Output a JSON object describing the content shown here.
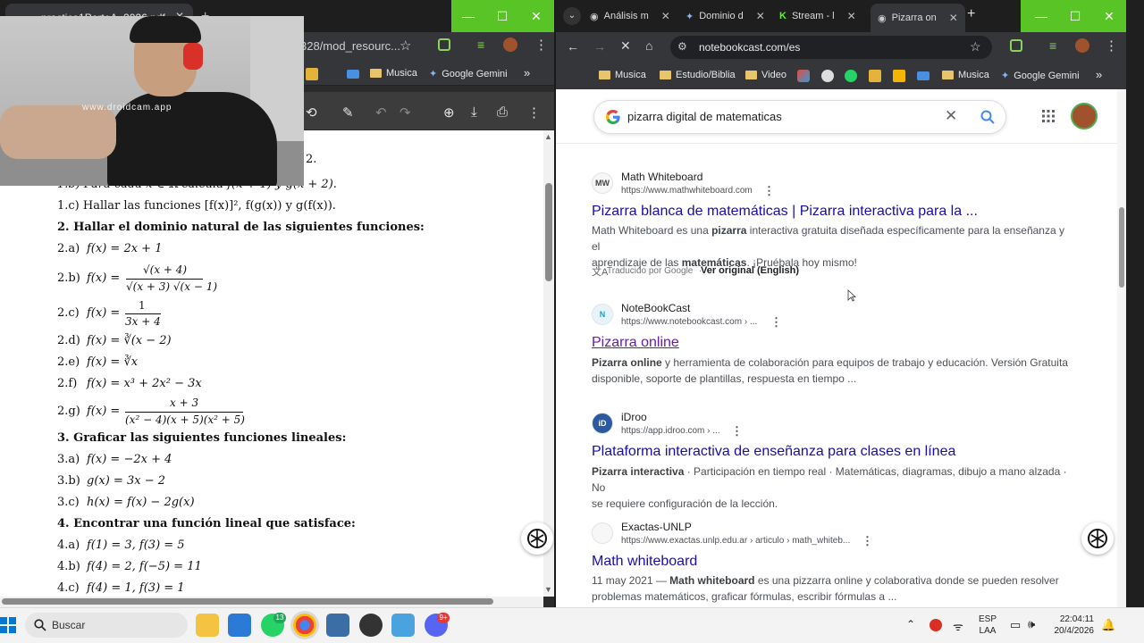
{
  "left_browser": {
    "tab_title": "practica1ParteA_2026.pdf",
    "url_fragment": "328/mod_resourc...",
    "bookmarks": [
      "Musica",
      "Google Gemini"
    ]
  },
  "webcam": {
    "watermark": "www.droidcam.app"
  },
  "pdf": {
    "lines": [
      {
        "k": "top_frag",
        "text": "2."
      },
      {
        "k": "line_b",
        "text": "1.b)  Para cada x ∈ ℝ calcula f(x + 1) y g(x + 2)."
      },
      {
        "k": "line_c",
        "text": "1.c)  Hallar las funciones [f(x)]², f(g(x)) y g(f(x))."
      }
    ],
    "ex2_title": "2.  Hallar el dominio natural de las siguientes funciones:",
    "ex2": {
      "a": {
        "label": "2.a)",
        "expr": "f(x) = 2x + 1"
      },
      "b": {
        "label": "2.b)",
        "lhs": "f(x) =",
        "num": "√(x + 4)",
        "den": "√(x + 3) √(x − 1)"
      },
      "c": {
        "label": "2.c)",
        "lhs": "f(x) =",
        "num": "1",
        "den": "3x + 4"
      },
      "d": {
        "label": "2.d)",
        "expr": "f(x) = ∛(x − 2)"
      },
      "e": {
        "label": "2.e)",
        "expr": "f(x) = ∛x"
      },
      "f": {
        "label": "2.f)",
        "expr": "f(x) = x³ + 2x² − 3x"
      },
      "g": {
        "label": "2.g)",
        "lhs": "f(x) =",
        "num": "x + 3",
        "den": "(x² − 4)(x + 5)(x² + 5)"
      }
    },
    "ex3_title": "3.  Graficar las siguientes funciones lineales:",
    "ex3": [
      {
        "label": "3.a)",
        "expr": "f(x) = −2x + 4"
      },
      {
        "label": "3.b)",
        "expr": "g(x) = 3x − 2"
      },
      {
        "label": "3.c)",
        "expr": "h(x) = f(x) − 2g(x)"
      }
    ],
    "ex4_title": "4.  Encontrar una función lineal que satisface:",
    "ex4": [
      {
        "label": "4.a)",
        "expr": "f(1) = 3,  f(3) = 5"
      },
      {
        "label": "4.b)",
        "expr": "f(4) = 2,  f(−5) = 11"
      },
      {
        "label": "4.c)",
        "expr": "f(4) = 1,  f(3) = 1"
      }
    ]
  },
  "right_browser": {
    "tabs": [
      "Análisis m",
      "Dominio d",
      "Stream - l",
      "Pizarra on"
    ],
    "url": "notebookcast.com/es",
    "bookmarks": [
      "Musica",
      "Estudio/Biblia",
      "Video",
      "Musica",
      "Google Gemini"
    ]
  },
  "google": {
    "query": "pizarra digital de matematicas",
    "results": [
      {
        "fav": "MW",
        "site": "Math Whiteboard",
        "url": "https://www.mathwhiteboard.com",
        "title": "Pizarra blanca de matemáticas | Pizarra interactiva para la ...",
        "snippet_1": "Math Whiteboard es una pizarra interactiva gratuita diseñada específicamente para la enseñanza y el",
        "snippet_2": "aprendizaje de las matemáticas. ¡Pruébala hoy mismo!",
        "translated": "Traducido por Google",
        "original": "Ver original (English)"
      },
      {
        "fav": "N",
        "site": "NoteBookCast",
        "url": "https://www.notebookcast.com › ...",
        "title": "Pizarra online",
        "snippet_1": "Pizarra online y herramienta de colaboración para equipos de trabajo y educación. Versión Gratuita",
        "snippet_2": "disponible, soporte de plantillas, respuesta en tiempo ..."
      },
      {
        "fav": "iD",
        "site": "iDroo",
        "url": "https://app.idroo.com › ...",
        "title": "Plataforma interactiva de enseñanza para clases en línea",
        "snippet_1": "Pizarra interactiva · Participación en tiempo real · Matemáticas, diagramas, dibujo a mano alzada · No",
        "snippet_2": "se requiere configuración de la lección."
      },
      {
        "fav": "",
        "site": "Exactas-UNLP",
        "url": "https://www.exactas.unlp.edu.ar › articulo › math_whiteb...",
        "title": "Math whiteboard",
        "snippet_1": "11 may 2021 — Math whiteboard es una pizzarra online y colaborativa donde se pueden resolver",
        "snippet_2": "problemas matemáticos, graficar fórmulas, escribir fórmulas a ..."
      }
    ]
  },
  "taskbar": {
    "search_placeholder": "Buscar",
    "lang_1": "ESP",
    "lang_2": "LAA",
    "time": "22:04:11",
    "date": "20/4/2026",
    "badge_whatsapp": "13",
    "badge_discord": "9+"
  },
  "colors": {
    "window_green": "#58c426",
    "link_blue": "#1a0dab",
    "dark_chrome": "#35363a"
  }
}
